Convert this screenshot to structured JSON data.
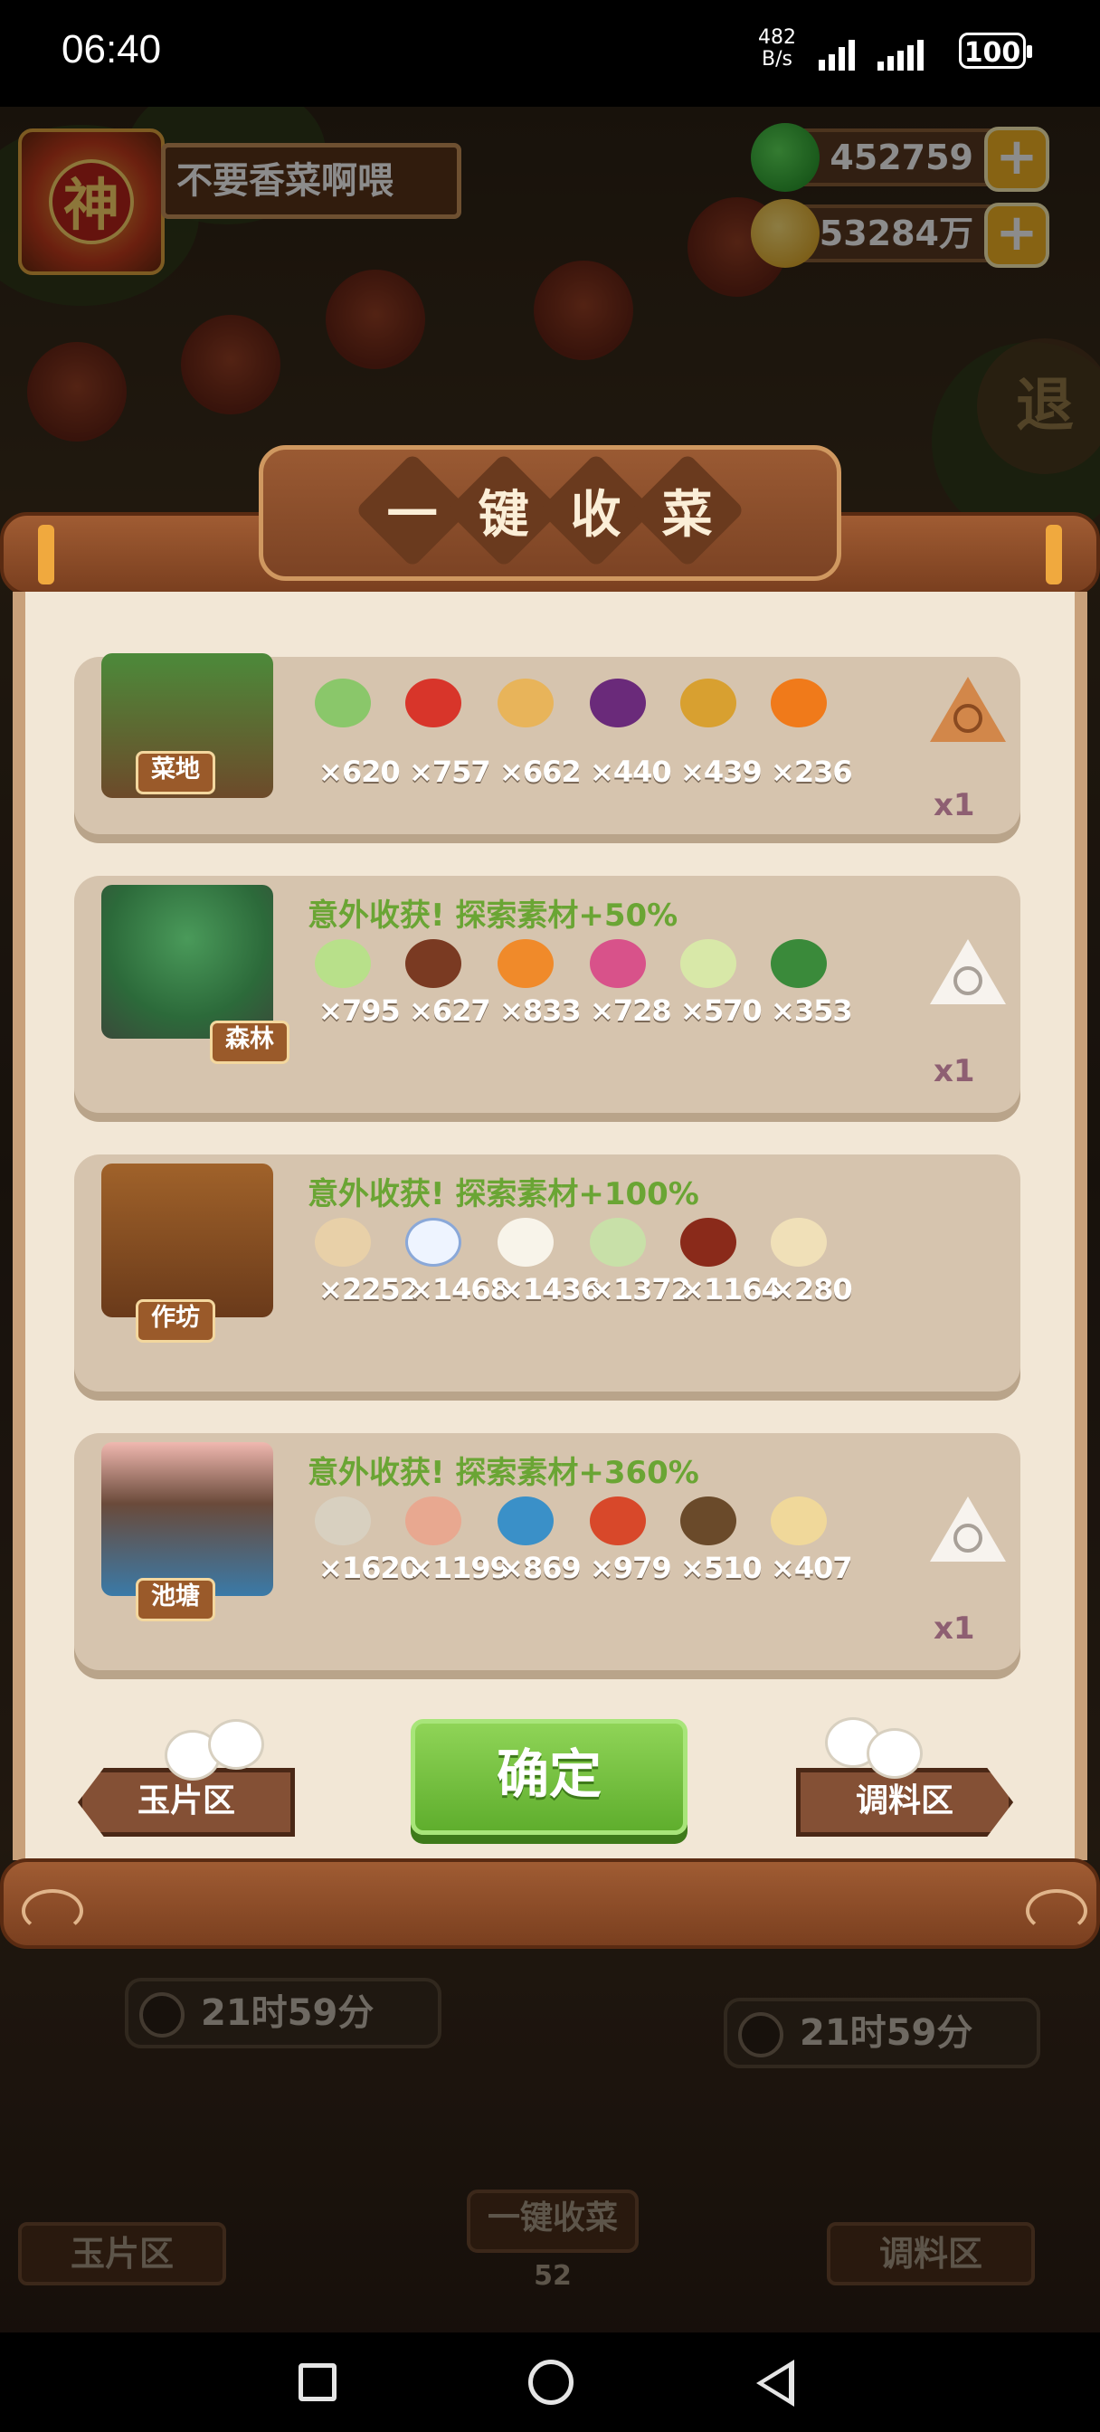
{
  "status_bar": {
    "time": "06:40",
    "net_speed": "482",
    "net_unit": "B/s",
    "battery": "100"
  },
  "player": {
    "name": "不要香菜啊喂",
    "avatar_char": "神"
  },
  "currency": {
    "jade": "452759",
    "gold": "53284万"
  },
  "exit_label": "退",
  "dialog": {
    "title_chars": [
      "一",
      "键",
      "收",
      "菜"
    ],
    "cards": [
      {
        "zone": "菜地",
        "bonus": "",
        "counts": [
          "×620",
          "×757",
          "×662",
          "×440",
          "×439",
          "×236"
        ],
        "multiplier": "x1"
      },
      {
        "zone": "森林",
        "bonus": "意外收获!  探索素材+50%",
        "counts": [
          "×795",
          "×627",
          "×833",
          "×728",
          "×570",
          "×353"
        ],
        "multiplier": "x1"
      },
      {
        "zone": "作坊",
        "bonus": "意外收获!  探索素材+100%",
        "counts": [
          "×2252",
          "×1468",
          "×1436",
          "×1372",
          "×1164",
          "×280"
        ],
        "multiplier": ""
      },
      {
        "zone": "池塘",
        "bonus": "意外收获!  探索素材+360%",
        "counts": [
          "×1620",
          "×1199",
          "×869",
          "×979",
          "×510",
          "×407"
        ],
        "multiplier": "x1"
      }
    ],
    "confirm": "确定",
    "left_sign": "玉片区",
    "right_sign": "调料区"
  },
  "background": {
    "timer_left": "21时59分",
    "timer_right": "21时59分",
    "center_label": "一键收菜",
    "center_count": "52",
    "left_tag": "玉片区",
    "right_tag": "调料区"
  }
}
